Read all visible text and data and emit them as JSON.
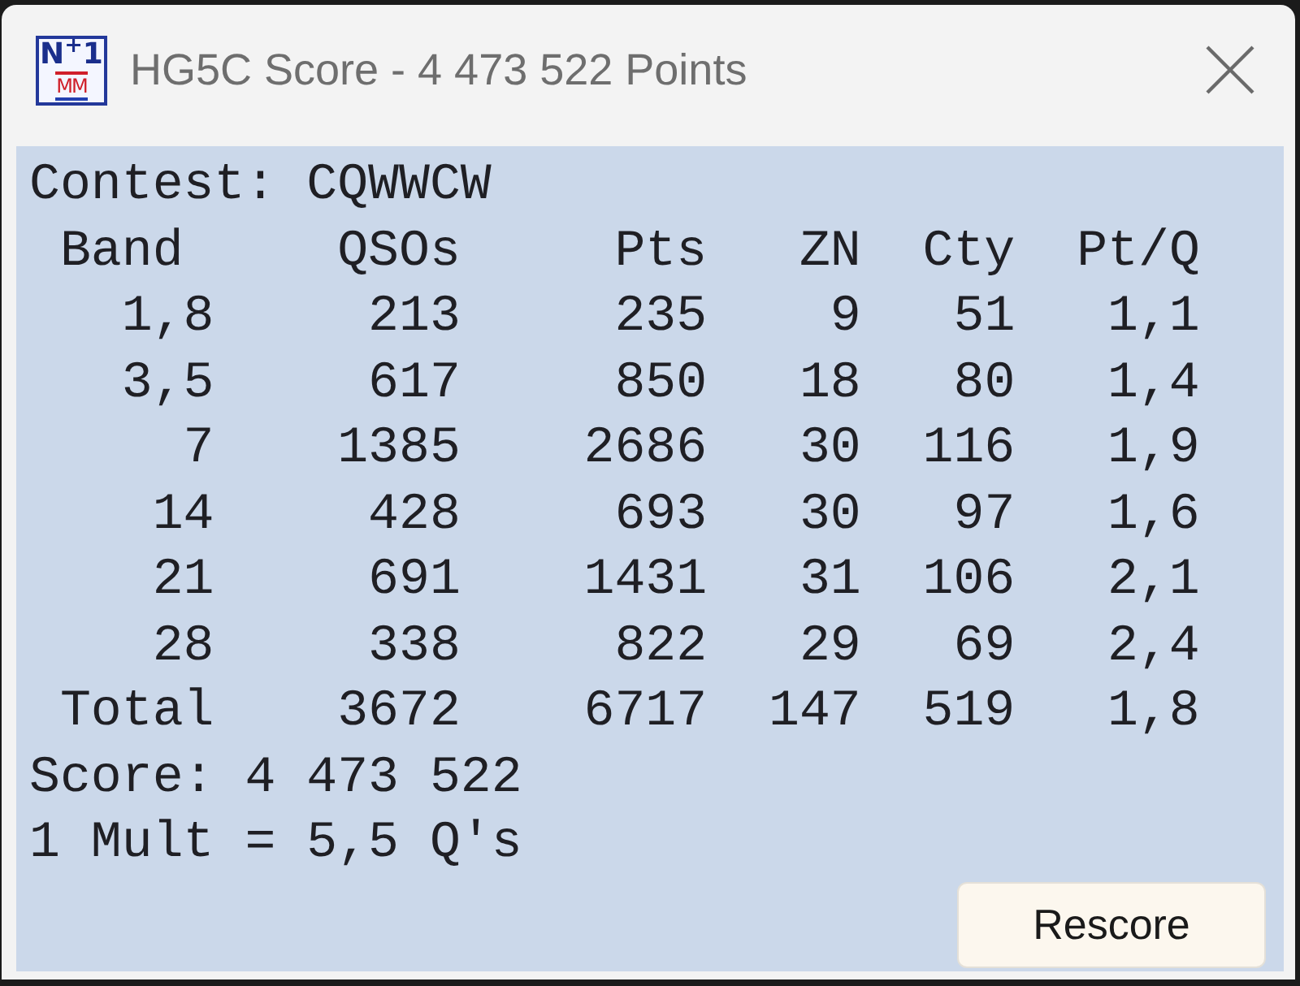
{
  "window": {
    "title": "HG5C Score - 4 473 522 Points",
    "logo": {
      "top": "N$^{+}$1",
      "bottom": "MM"
    }
  },
  "contest": "Contest: CQWWCW",
  "table": {
    "columns": [
      "Band",
      "QSOs",
      "Pts",
      "ZN",
      "Cty",
      "Pt/Q"
    ],
    "rows": [
      [
        "1,8",
        "213",
        "235",
        "9",
        "51",
        "1,1"
      ],
      [
        "3,5",
        "617",
        "850",
        "18",
        "80",
        "1,4"
      ],
      [
        "7",
        "1385",
        "2686",
        "30",
        "116",
        "1,9"
      ],
      [
        "14",
        "428",
        "693",
        "30",
        "97",
        "1,6"
      ],
      [
        "21",
        "691",
        "1431",
        "31",
        "106",
        "2,1"
      ],
      [
        "28",
        "338",
        "822",
        "29",
        "69",
        "2,4"
      ],
      [
        "Total",
        "3672",
        "6717",
        "147",
        "519",
        "1,8"
      ]
    ]
  },
  "summary": [
    "Score: 4 473 522",
    "1 Mult = 5,5 Q's"
  ],
  "buttons": [
    {
      "label": "Rescore"
    }
  ]
}
